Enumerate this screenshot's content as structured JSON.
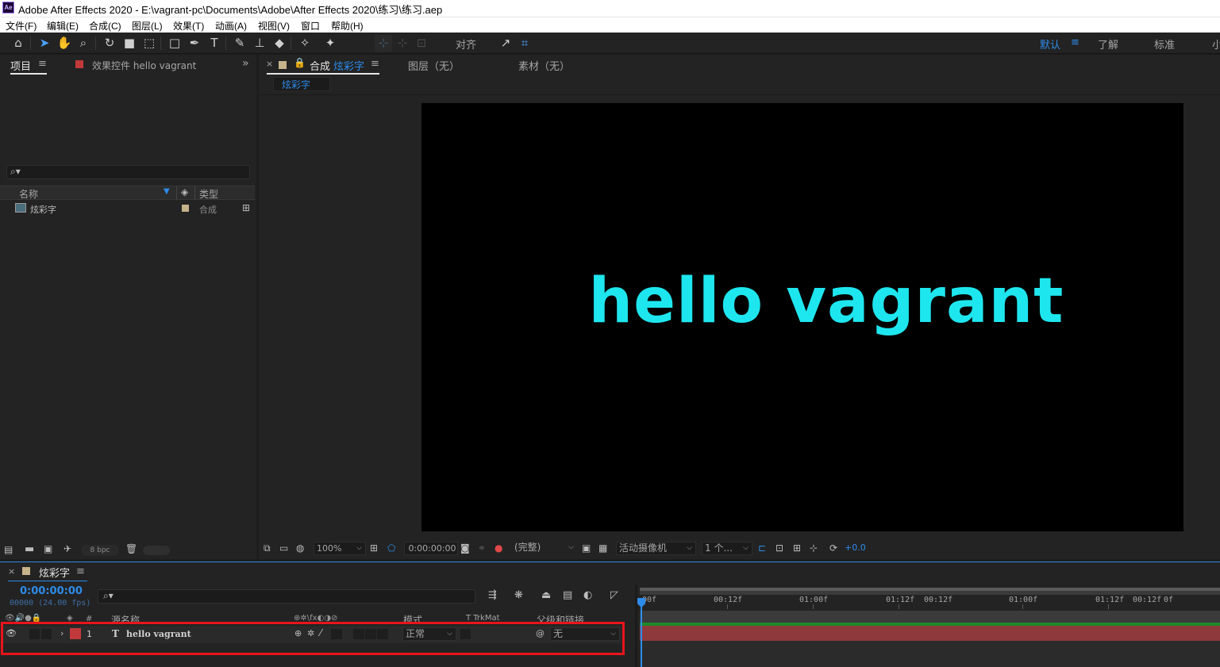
{
  "app": {
    "icon_label": "Ae",
    "title": "Adobe After Effects 2020 - E:\\vagrant-pc\\Documents\\Adobe\\After Effects 2020\\练习\\练习.aep"
  },
  "menu": [
    "文件(F)",
    "编辑(E)",
    "合成(C)",
    "图层(L)",
    "效果(T)",
    "动画(A)",
    "视图(V)",
    "窗口",
    "帮助(H)"
  ],
  "toolbar": {
    "snap_label": "对齐",
    "workspaces": [
      "默认",
      "了解",
      "标准",
      "小"
    ],
    "workspace_menu": "≡"
  },
  "project_panel": {
    "tab_project": "项目",
    "tab_effects": "效果控件 hello vagrant",
    "menu_glyph": "≡",
    "collapse_glyph": "»",
    "col_name": "名称",
    "col_type": "类型",
    "items": [
      {
        "name": "炫彩字",
        "type": "合成"
      }
    ],
    "bpc": "8 bpc"
  },
  "composition_panel": {
    "close": "×",
    "tab_comp": "合成",
    "comp_name": "炫彩字",
    "tab_layer": "图层（无）",
    "tab_footage": "素材（无）",
    "breadcrumb": "炫彩字",
    "canvas_text": "hello vagrant",
    "text_color": "#1ee6ee",
    "zoom": "100%",
    "timecode": "0:00:00:00",
    "resolution": "(完整)",
    "camera": "活动摄像机",
    "views": "1 个...",
    "exposure": "+0.0"
  },
  "timeline": {
    "close": "×",
    "comp_name": "炫彩字",
    "menu_glyph": "≡",
    "timecode": "0:00:00:00",
    "frame_info": "00000 (24.00 fps)",
    "col_source": "源名称",
    "col_mode": "模式",
    "col_trkmat": "T  TrkMat",
    "col_parent": "父级和链接",
    "col_num": "#",
    "ruler": [
      "00f",
      "00:12f",
      "01:00f",
      "01:12f",
      "00:12f",
      "01:00f",
      "01:12f",
      "00:12f",
      "0f"
    ],
    "layers": [
      {
        "num": "1",
        "type_icon": "T",
        "name": "hello vagrant",
        "mode": "正常",
        "parent": "无",
        "color": "#c2393b"
      }
    ]
  },
  "colors": {
    "accent": "#2d8ceb",
    "highlight_box": "#e8141c",
    "layer_bar": "#8e3a3c"
  }
}
